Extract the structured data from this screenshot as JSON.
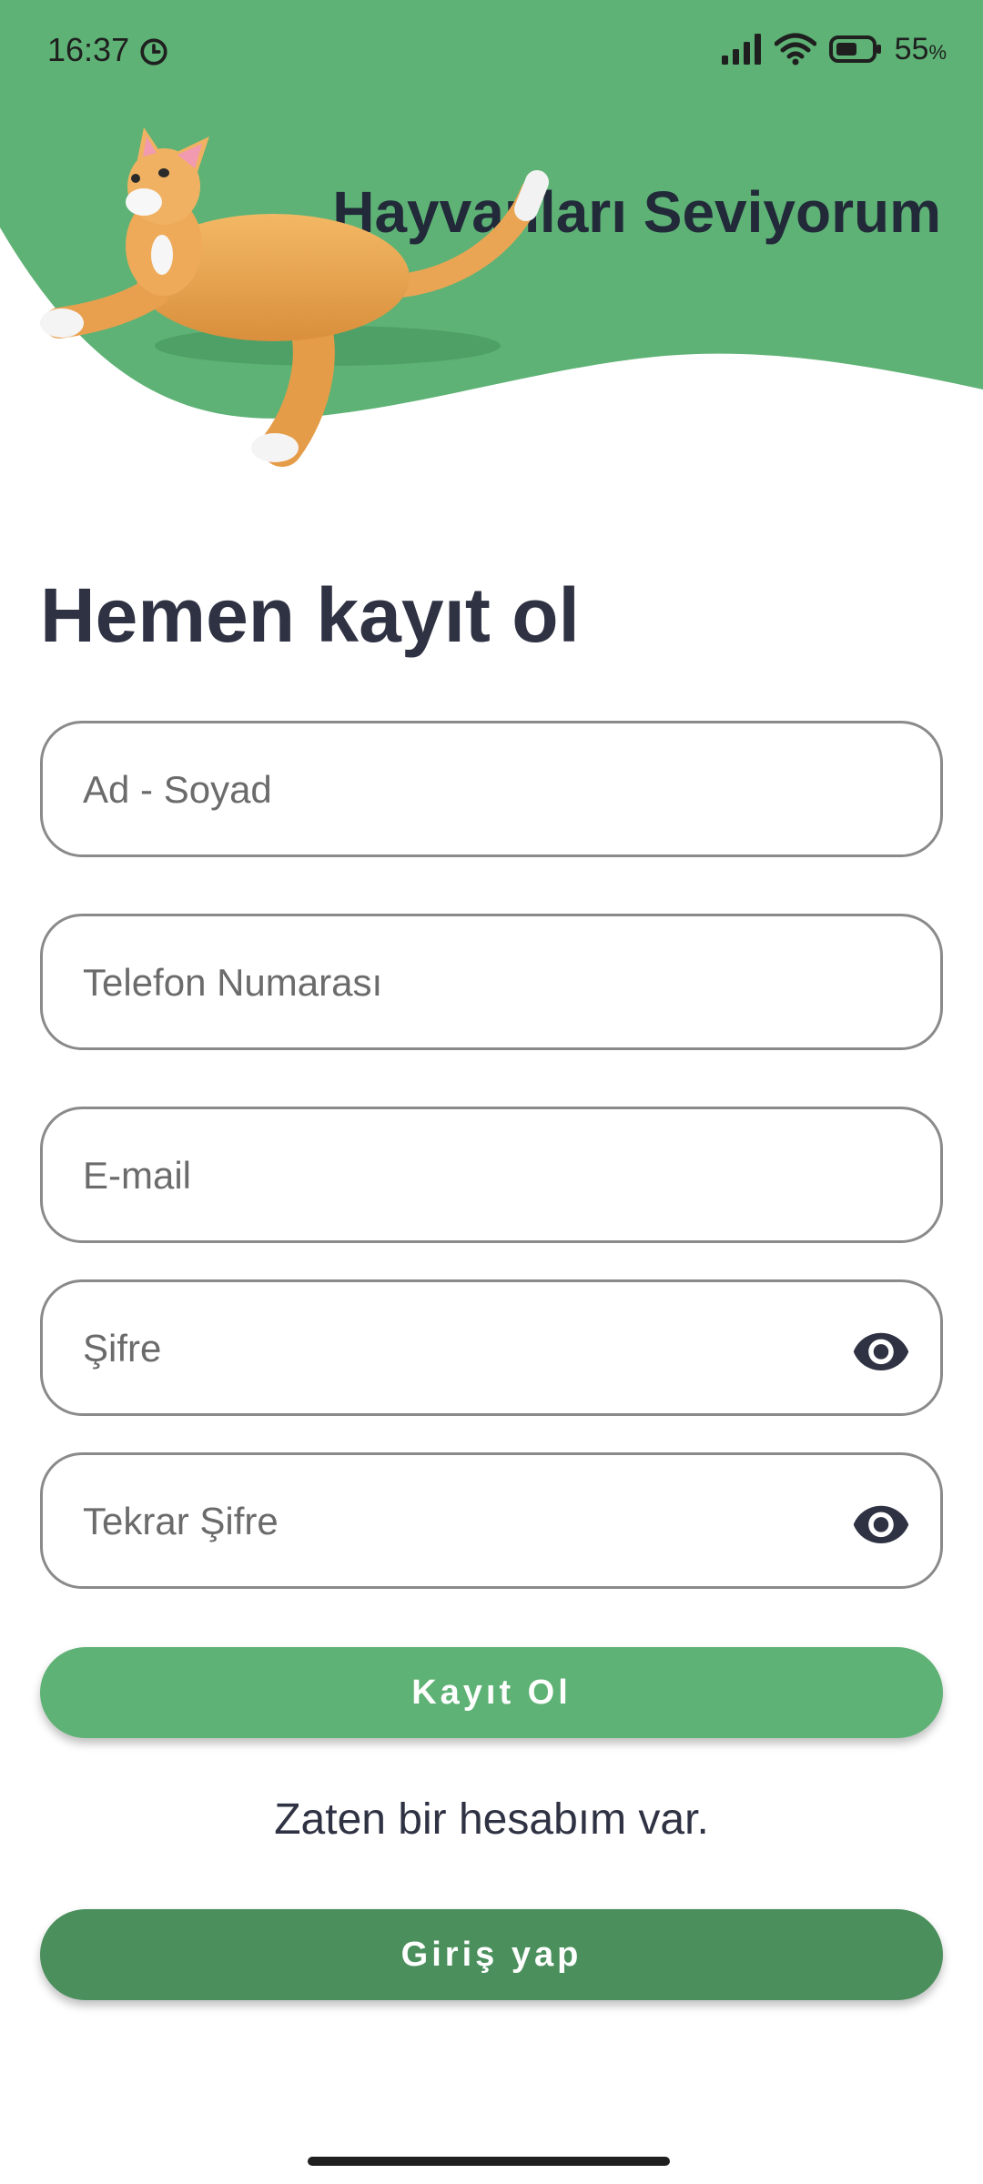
{
  "status_bar": {
    "time": "16:37",
    "battery_percent": "55",
    "battery_unit": "%",
    "icons": [
      "alarm-clock-icon",
      "signal-icon",
      "wifi-icon",
      "battery-icon"
    ]
  },
  "header": {
    "title": "Hayvanları Seviyorum",
    "bg_color": "#5eb275",
    "illustration": "cat-illustration"
  },
  "page": {
    "title": "Hemen kayıt ol"
  },
  "form": {
    "name_placeholder": "Ad - Soyad",
    "phone_placeholder": "Telefon Numarası",
    "email_placeholder": "E-mail",
    "password_placeholder": "Şifre",
    "password_repeat_placeholder": "Tekrar Şifre",
    "visibility_icon": "eye-icon"
  },
  "actions": {
    "register_label": "Kayıt Ol",
    "have_account_text": "Zaten bir hesabım var.",
    "login_label": "Giriş yap"
  },
  "colors": {
    "primary": "#5eb275",
    "primary_dark": "#4a8f5c",
    "title_text": "#2f3243",
    "field_border": "#8a8a8a"
  }
}
